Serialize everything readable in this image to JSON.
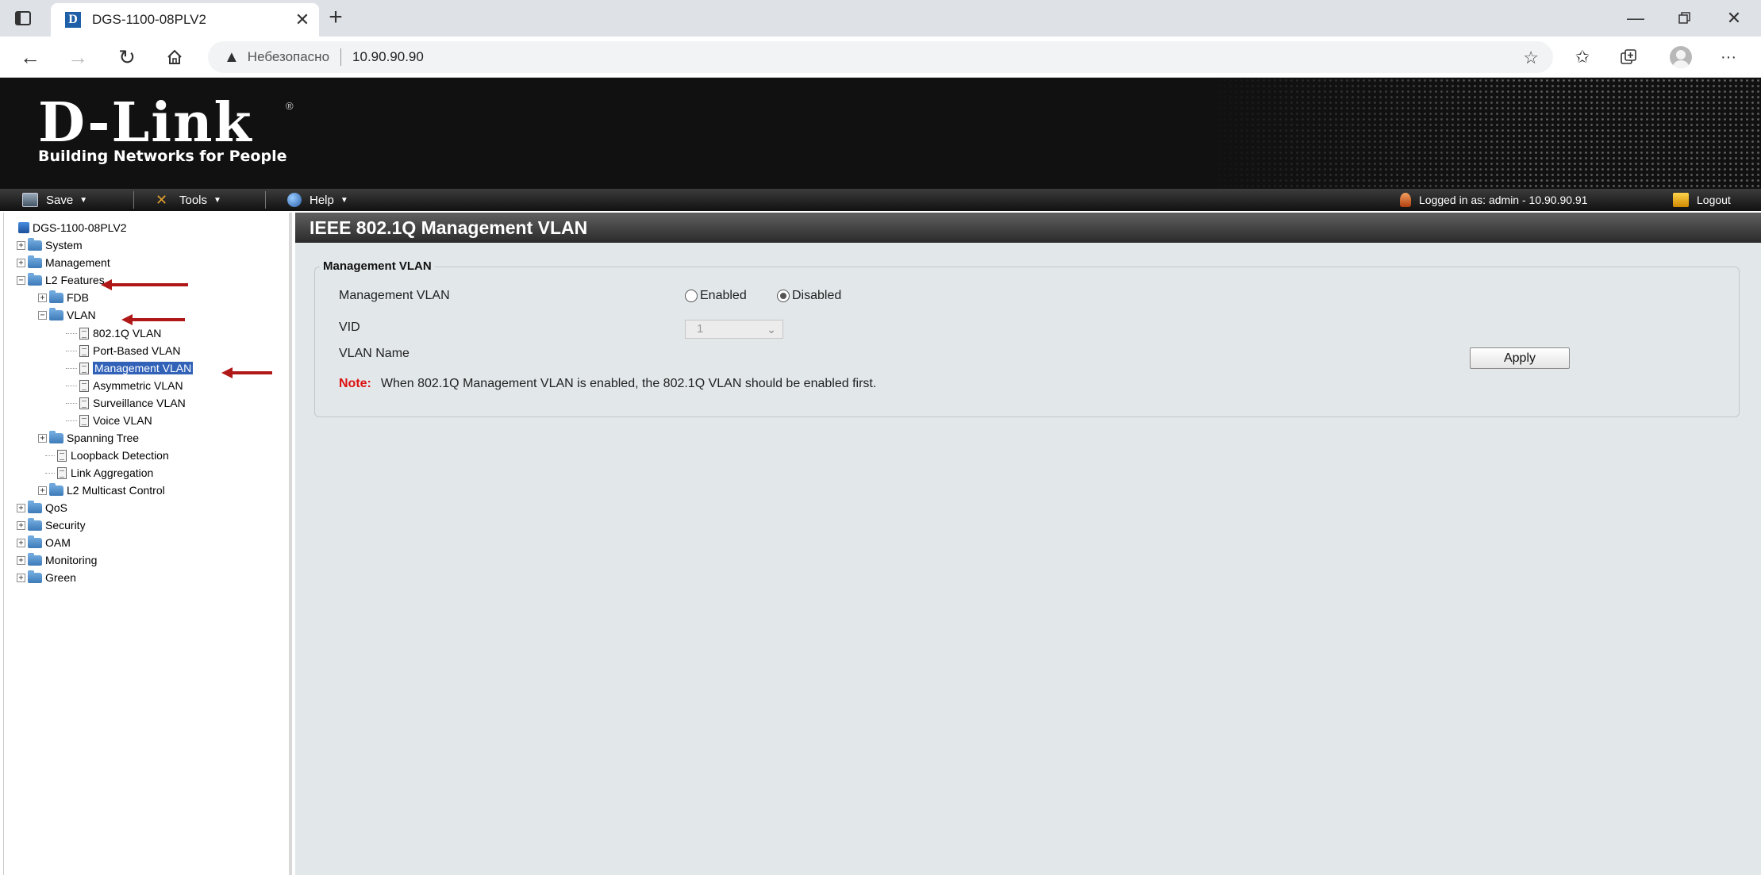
{
  "browser": {
    "tab_title": "DGS-1100-08PLV2",
    "tab_favicon_letter": "D",
    "insecure_label": "Небезопасно",
    "url": "10.90.90.90"
  },
  "header": {
    "logo": "D-Link",
    "tagline": "Building Networks for People"
  },
  "menu": {
    "save": "Save",
    "tools": "Tools",
    "help": "Help",
    "logged_in": "Logged in as: admin - 10.90.90.91",
    "logout": "Logout"
  },
  "tree": {
    "root": "DGS-1100-08PLV2",
    "system": "System",
    "management": "Management",
    "l2_features": "L2 Features",
    "fdb": "FDB",
    "vlan": "VLAN",
    "vlan_8021q": "802.1Q VLAN",
    "port_based_vlan": "Port-Based VLAN",
    "management_vlan": "Management VLAN",
    "asymmetric_vlan": "Asymmetric VLAN",
    "surveillance_vlan": "Surveillance VLAN",
    "voice_vlan": "Voice VLAN",
    "spanning_tree": "Spanning Tree",
    "loopback_detection": "Loopback Detection",
    "link_aggregation": "Link Aggregation",
    "l2_multicast_control": "L2 Multicast Control",
    "qos": "QoS",
    "security": "Security",
    "oam": "OAM",
    "monitoring": "Monitoring",
    "green": "Green"
  },
  "content": {
    "page_title": "IEEE 802.1Q Management VLAN",
    "section_legend": "Management VLAN",
    "mgmt_vlan_label": "Management VLAN",
    "enabled_label": "Enabled",
    "disabled_label": "Disabled",
    "selected_state": "Disabled",
    "vid_label": "VID",
    "vid_value": "1",
    "vlan_name_label": "VLAN Name",
    "apply_label": "Apply",
    "note_label": "Note:",
    "note_text": "When 802.1Q Management VLAN is enabled, the 802.1Q VLAN should be enabled first."
  },
  "colors": {
    "selected_item": "#3162b8",
    "note_label": "#dd1111",
    "annotation_arrow": "#b01818"
  }
}
